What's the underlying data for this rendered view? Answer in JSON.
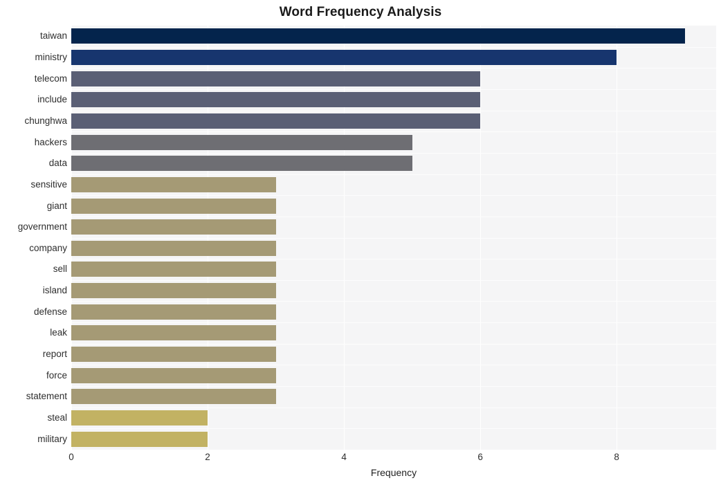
{
  "chart_data": {
    "type": "bar",
    "orientation": "horizontal",
    "title": "Word Frequency Analysis",
    "xlabel": "Frequency",
    "ylabel": "",
    "categories": [
      "taiwan",
      "ministry",
      "telecom",
      "include",
      "chunghwa",
      "hackers",
      "data",
      "sensitive",
      "giant",
      "government",
      "company",
      "sell",
      "island",
      "defense",
      "leak",
      "report",
      "force",
      "statement",
      "steal",
      "military"
    ],
    "values": [
      9,
      8,
      6,
      6,
      6,
      5,
      5,
      3,
      3,
      3,
      3,
      3,
      3,
      3,
      3,
      3,
      3,
      3,
      2,
      2
    ],
    "bar_colors": [
      "#04244c",
      "#17356e",
      "#5a5f75",
      "#5a5f75",
      "#5a5f75",
      "#6e6e73",
      "#6e6e73",
      "#a59a75",
      "#a59a75",
      "#a59a75",
      "#a59a75",
      "#a59a75",
      "#a59a75",
      "#a59a75",
      "#a59a75",
      "#a59a75",
      "#a59a75",
      "#a59a75",
      "#c2b263",
      "#c2b263"
    ],
    "xlim": [
      0,
      9.46
    ],
    "xticks": [
      0,
      2,
      4,
      6,
      8
    ],
    "xticklabels": [
      "0",
      "2",
      "4",
      "6",
      "8"
    ],
    "grid": true,
    "grid_color": "#ffffff",
    "plot_background": "#f5f5f6",
    "figure_background": "#ffffff",
    "legend": "none"
  }
}
